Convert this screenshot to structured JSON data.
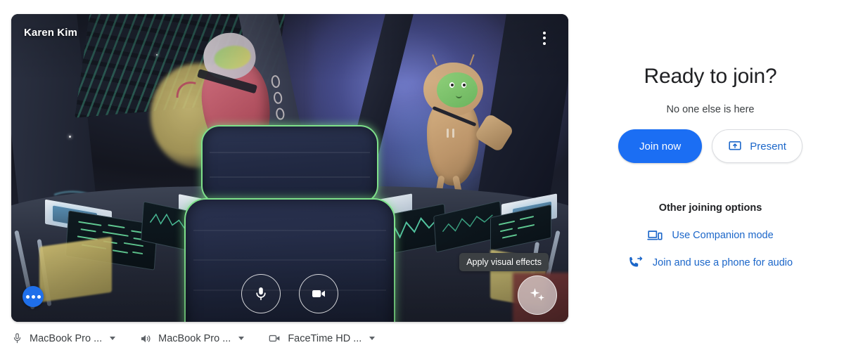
{
  "preview": {
    "self_name": "Karen Kim",
    "kebab_menu_label": "More options",
    "more_options_label": "More options",
    "mic_button_label": "Turn off microphone",
    "camera_button_label": "Turn off camera",
    "effects_button_label": "Apply visual effects",
    "effects_tooltip": "Apply visual effects",
    "background": "spaceship cockpit with two cartoon astronaut characters"
  },
  "devices": [
    {
      "icon": "microphone-icon",
      "label": "MacBook Pro ..."
    },
    {
      "icon": "speaker-icon",
      "label": "MacBook Pro ..."
    },
    {
      "icon": "camera-icon",
      "label": "FaceTime HD ..."
    }
  ],
  "join": {
    "title": "Ready to join?",
    "subtitle": "No one else is here",
    "join_now_label": "Join now",
    "present_label": "Present",
    "other_options_title": "Other joining options",
    "options": [
      {
        "icon": "companion-mode-icon",
        "label": "Use Companion mode"
      },
      {
        "icon": "phone-audio-icon",
        "label": "Join and use a phone for audio"
      }
    ]
  },
  "colors": {
    "google_blue": "#1b6ef3",
    "link_blue": "#1b66c9",
    "text_primary": "#202124",
    "text_secondary": "#3c4043",
    "tooltip_bg": "#3c4043",
    "seat_glow_green": "#7ee08a",
    "page_bg": "#ffffff"
  }
}
